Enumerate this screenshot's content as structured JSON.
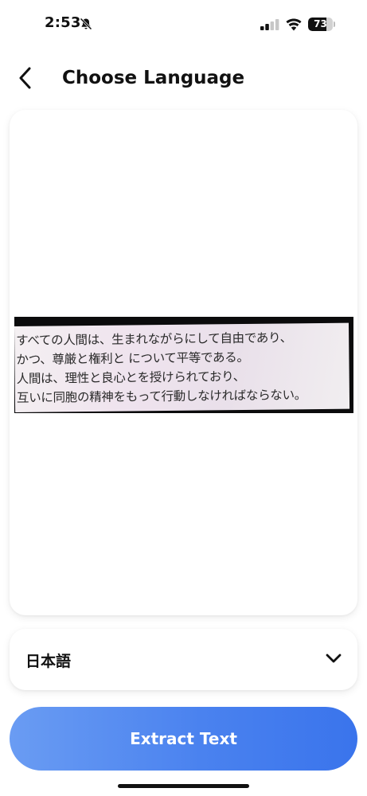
{
  "status_bar": {
    "time": "2:53",
    "battery_percent": 73,
    "battery_label": "73",
    "icons": [
      "bell-slash-icon",
      "signal-icon",
      "wifi-icon",
      "battery-icon"
    ]
  },
  "header": {
    "back_icon": "chevron-left-icon",
    "title": "Choose Language"
  },
  "image_preview": {
    "lines": [
      "すべての人間は、生まれながらにして自由であり、",
      "かつ、尊厳と権利と について平等である。",
      "人間は、理性と良心とを授けられており、",
      "互いに同胞の精神をもって行動しなければならない。"
    ]
  },
  "language_select": {
    "selected": "日本語",
    "icon": "chevron-down-icon"
  },
  "extract_button": {
    "label": "Extract Text"
  },
  "colors": {
    "accent_start": "#6a9cf3",
    "accent_end": "#3a74ec",
    "text": "#111111"
  }
}
